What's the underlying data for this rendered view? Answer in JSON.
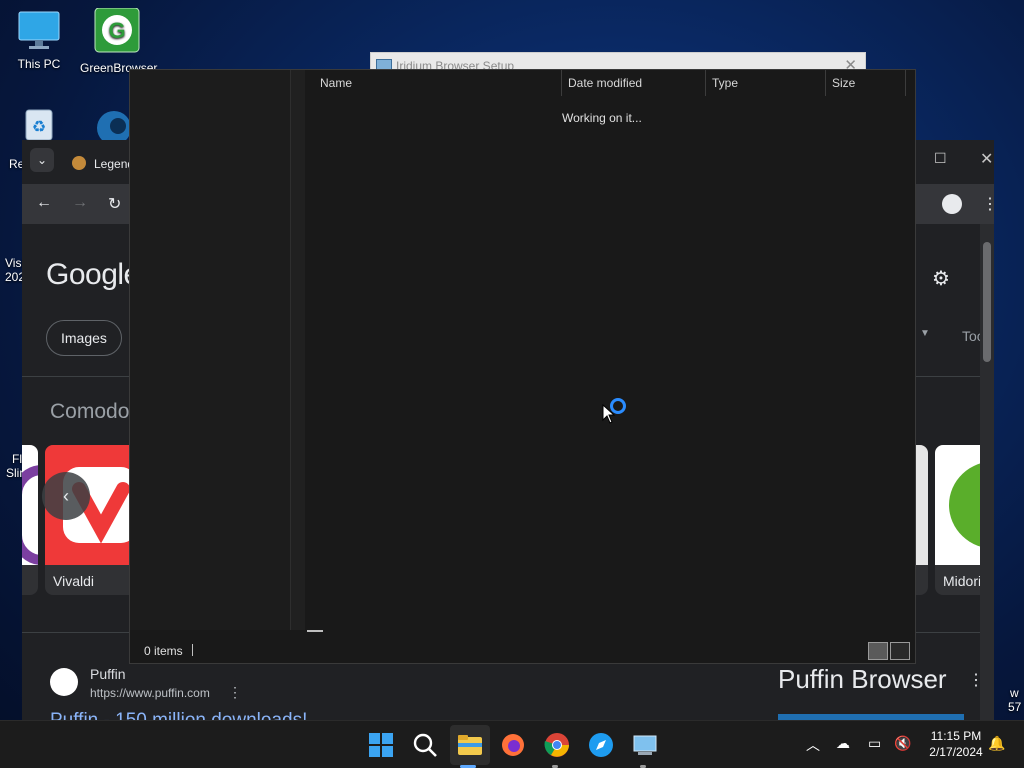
{
  "desktop": {
    "icons": [
      {
        "label": "This PC"
      },
      {
        "label": "GreenBrowser"
      }
    ],
    "edge_labels": [
      "Re",
      "Visi",
      "202",
      "Fl",
      "Slin"
    ],
    "right_edge_labels": [
      "w",
      "57"
    ]
  },
  "setup_window": {
    "title": "Iridium Browser Setup",
    "close": "✕"
  },
  "chrome": {
    "tab_title": "Legend",
    "google_logo": "Google",
    "filter_chip": "Images",
    "tools": "Tools",
    "section_heading": "Comodo",
    "cards": [
      {
        "name": "Vivaldi"
      },
      {
        "name": "Midori"
      }
    ],
    "result": {
      "site_name": "Puffin",
      "url": "https://www.puffin.com",
      "link_text": "Puffin - 150 million downloads!"
    },
    "knowledge_panel_title": "Puffin Browser",
    "colors": {
      "background": "#202124",
      "link": "#8ab4f8"
    }
  },
  "dialog": {
    "columns": [
      "Name",
      "Date modified",
      "Type",
      "Size"
    ],
    "status_message": "Working on it...",
    "item_count": "0 items"
  },
  "taskbar": {
    "time": "11:15 PM",
    "date": "2/17/2024",
    "apps": [
      "start-icon",
      "search-icon",
      "file-explorer-icon",
      "firefox-icon",
      "chrome-icon",
      "safari-like-icon",
      "setup-icon"
    ]
  }
}
